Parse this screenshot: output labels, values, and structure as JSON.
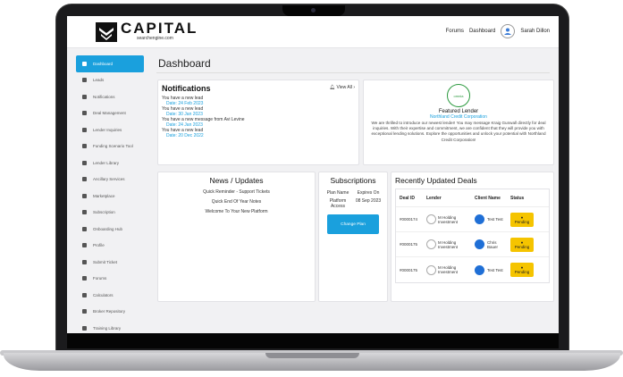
{
  "brand": {
    "name": "CAPITAL",
    "sub": "searchengine.com"
  },
  "topnav": {
    "forums": "Forums",
    "dashboard": "Dashboard",
    "user": "Sarah Dillon"
  },
  "sidebar": {
    "items": [
      {
        "label": "Dashboard",
        "icon": "home-icon",
        "active": true
      },
      {
        "label": "Leads",
        "icon": "chart-icon"
      },
      {
        "label": "Notifications",
        "icon": "bell-icon"
      },
      {
        "label": "Deal Management",
        "icon": "folder-icon"
      },
      {
        "label": "Lender Inquiries",
        "icon": "chat-icon"
      },
      {
        "label": "Funding Scenario Tool",
        "icon": "search-icon"
      },
      {
        "label": "Lender Library",
        "icon": "book-icon"
      },
      {
        "label": "Ancillary Services",
        "icon": "link-icon"
      },
      {
        "label": "Marketplace",
        "icon": "chevron-right-icon"
      },
      {
        "label": "Subscription",
        "icon": "dollar-icon"
      },
      {
        "label": "Onboarding Hub",
        "icon": "grid-icon"
      },
      {
        "label": "Profile",
        "icon": "user-icon"
      },
      {
        "label": "Submit Ticket",
        "icon": "question-icon"
      },
      {
        "label": "Forums",
        "icon": "forum-icon"
      },
      {
        "label": "Calculators",
        "icon": "calculator-icon"
      },
      {
        "label": "Broker Repository",
        "icon": "bookmark-icon"
      },
      {
        "label": "Training Library",
        "icon": "training-icon"
      }
    ]
  },
  "main": {
    "title": "Dashboard"
  },
  "notifications": {
    "title": "Notifications",
    "view_all": "View All",
    "items": [
      {
        "text": "You have a new lead",
        "date": "Date: 24 Feb 2023"
      },
      {
        "text": "You have a new lead",
        "date": "Date: 30 Jan 2023"
      },
      {
        "text": "You have a new message from Avi Levine",
        "date": "Date: 24 Jan 2023"
      },
      {
        "text": "You have a new lead",
        "date": "Date: 20 Dec 2022"
      }
    ]
  },
  "featured": {
    "logo": "omnia",
    "title": "Featured Lender",
    "lender": "Northland Credit Corporation",
    "desc": "We are thrilled to introduce our newest lender! You may message Kraig Gunwall directly for deal inquiries. With their expertise and commitment, we are confident that they will provide you with exceptional lending solutions. Explore the opportunities and unlock your potential with Northland Credit Corporation!"
  },
  "news": {
    "title": "News / Updates",
    "items": [
      "Quick Reminder - Support Tickets",
      "Quick End Of Year Notes",
      "Welcome To Your New Platform"
    ]
  },
  "subscriptions": {
    "title": "Subscriptions",
    "col1": "Plan Name",
    "col2": "Expires On",
    "plan": "Platform Access",
    "expires": "08 Sep 2023",
    "button": "Change Plan"
  },
  "deals": {
    "title": "Recently Updated Deals",
    "headers": [
      "Deal ID",
      "Lender",
      "Client Name",
      "Status"
    ],
    "rows": [
      {
        "id": "#0000174",
        "lender": "M Holding Investment",
        "client": "Test Test",
        "status": "Pending"
      },
      {
        "id": "#0000175",
        "lender": "M Holding Investment",
        "client": "Chris Bauer",
        "status": "Pending"
      },
      {
        "id": "#0000175",
        "lender": "M Holding Investment",
        "client": "Test Test",
        "status": "Pending"
      }
    ]
  },
  "colors": {
    "accent": "#1aa0dd",
    "pending": "#f5c400"
  }
}
